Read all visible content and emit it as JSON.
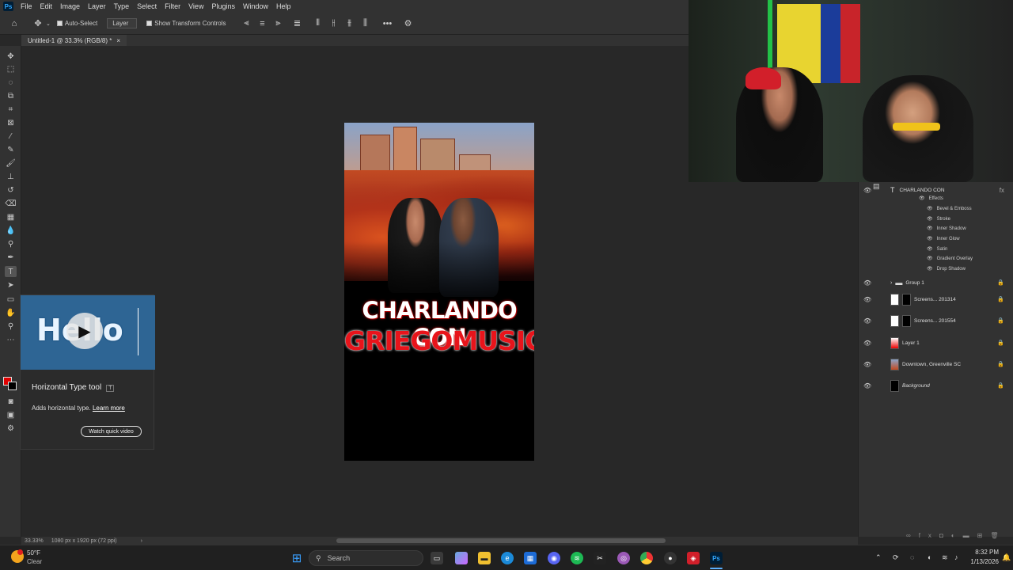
{
  "app": {
    "logo": "Ps"
  },
  "menu": [
    "File",
    "Edit",
    "Image",
    "Layer",
    "Type",
    "Select",
    "Filter",
    "View",
    "Plugins",
    "Window",
    "Help"
  ],
  "options_bar": {
    "auto_select_label": "Auto-Select",
    "layer_dropdown": "Layer",
    "transform_label": "Show Transform Controls",
    "more": "•••"
  },
  "document_tab": {
    "title": "Untitled-1 @ 33.3% (RGB/8) *",
    "close": "×"
  },
  "artwork": {
    "line1": "CHARLANDO CON",
    "line2": "GRIEGOMUSIC"
  },
  "tooltip": {
    "preview_text": "Hello",
    "title": "Horizontal Type tool",
    "shortcut": "T",
    "description": "Adds horizontal type.",
    "learn_more": "Learn more",
    "button": "Watch quick video"
  },
  "layers": {
    "active_layer": "CHARLANDO CON",
    "effects_label": "Effects",
    "effects": [
      "Bevel & Emboss",
      "Stroke",
      "Inner Shadow",
      "Inner Glow",
      "Satin",
      "Gradient Overlay",
      "Drop Shadow"
    ],
    "items": [
      {
        "name": "Group 1",
        "type": "group"
      },
      {
        "name": "Screens... 201314",
        "type": "image"
      },
      {
        "name": "Screens... 201554",
        "type": "image"
      },
      {
        "name": "Layer 1",
        "type": "fill"
      },
      {
        "name": "Downtown, Greenville SC",
        "type": "photo"
      },
      {
        "name": "Background",
        "type": "background"
      }
    ]
  },
  "status": {
    "zoom": "33.33%",
    "doc_info": "1080 px x 1920 px (72 ppi)"
  },
  "taskbar": {
    "weather_temp": "50°F",
    "weather_desc": "Clear",
    "search_placeholder": "Search",
    "time": "8:32 PM",
    "date": "1/13/2026"
  },
  "colors": {
    "accent": "#31a8ff",
    "title_red": "#e8141b",
    "foreground_swatch": "#e00000"
  }
}
